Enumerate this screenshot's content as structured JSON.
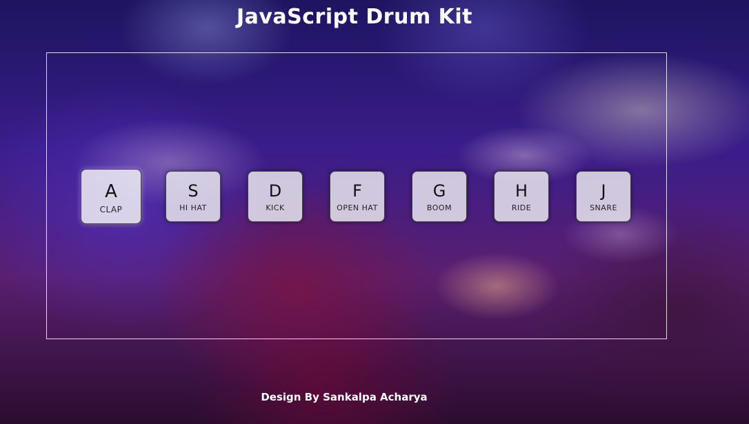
{
  "page": {
    "title": "JavaScript Drum Kit",
    "footer": "Design By Sankalpa Acharya"
  },
  "background": {
    "description_icon": "drummer-stage-photo"
  },
  "keys": [
    {
      "letter": "A",
      "sound": "CLAP",
      "state": "playing"
    },
    {
      "letter": "S",
      "sound": "HI HAT"
    },
    {
      "letter": "D",
      "sound": "KICK"
    },
    {
      "letter": "F",
      "sound": "OPEN HAT"
    },
    {
      "letter": "G",
      "sound": "BOOM"
    },
    {
      "letter": "H",
      "sound": "RIDE"
    },
    {
      "letter": "J",
      "sound": "SNARE"
    }
  ],
  "colors": {
    "key_bg": "#e8e6ee",
    "text": "#ffffff"
  }
}
